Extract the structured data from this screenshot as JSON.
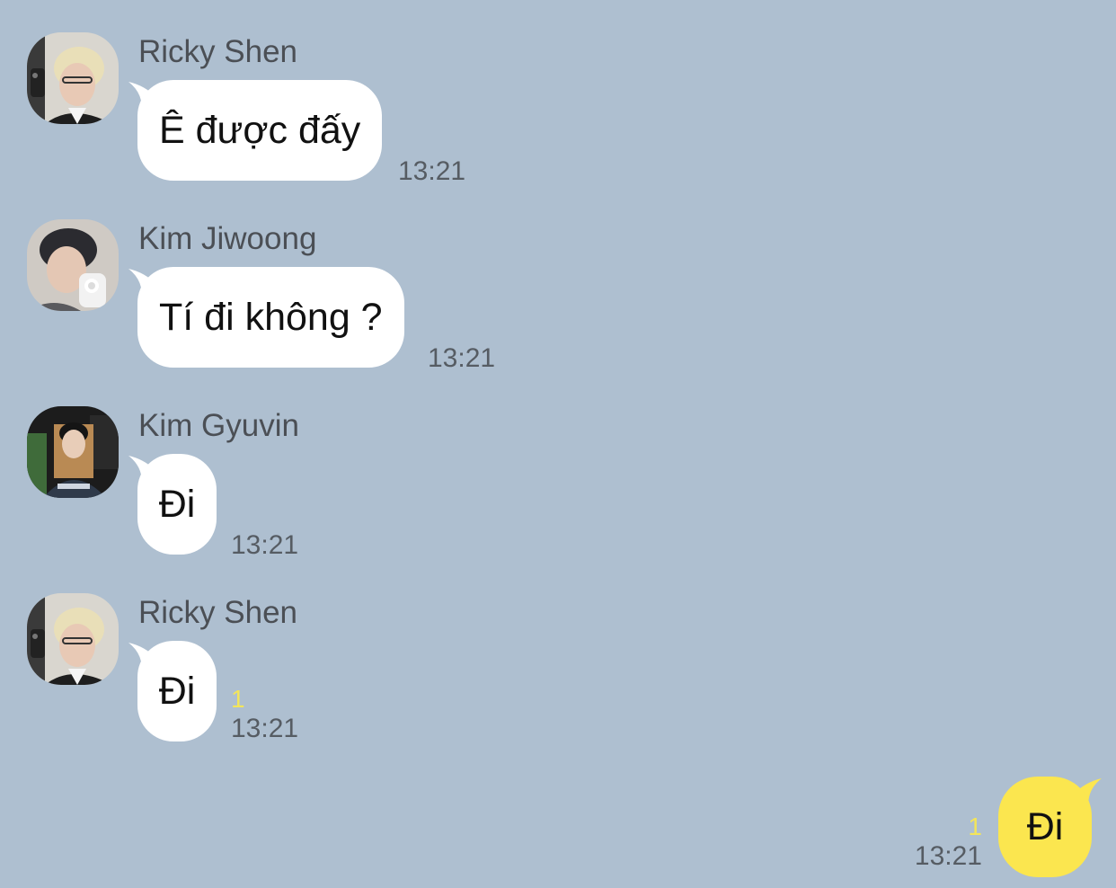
{
  "messages": [
    {
      "sender": "Ricky Shen",
      "text": "Ê được đấy",
      "time": "13:21",
      "unread": ""
    },
    {
      "sender": "Kim Jiwoong",
      "text": "Tí đi không ?",
      "time": "13:21",
      "unread": ""
    },
    {
      "sender": "Kim Gyuvin",
      "text": "Đi",
      "time": "13:21",
      "unread": ""
    },
    {
      "sender": "Ricky Shen",
      "text": "Đi",
      "time": "13:21",
      "unread": "1"
    }
  ],
  "my_message": {
    "text": "Đi",
    "time": "13:21",
    "unread": "1"
  },
  "colors": {
    "background": "#aebfd0",
    "incoming_bubble": "#ffffff",
    "outgoing_bubble": "#fbe64f",
    "unread_count": "#f3e55a",
    "timestamp": "#565c63"
  }
}
